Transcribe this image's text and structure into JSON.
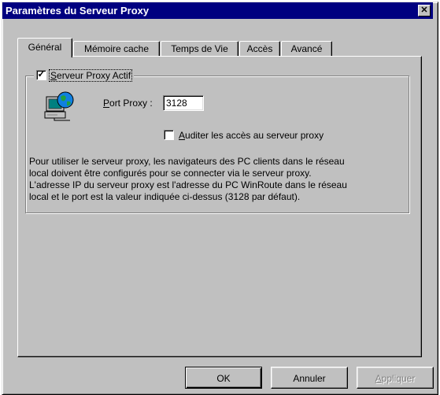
{
  "window": {
    "title": "Paramètres du Serveur Proxy",
    "close_glyph": "✕"
  },
  "tabs": [
    {
      "label": "Général",
      "active": true
    },
    {
      "label": "Mémoire cache",
      "active": false
    },
    {
      "label": "Temps de Vie",
      "active": false
    },
    {
      "label": "Accès",
      "active": false
    },
    {
      "label": "Avancé",
      "active": false
    }
  ],
  "proxy_group": {
    "enable_label_underlined": "S",
    "enable_label_rest": "erveur Proxy Actif",
    "enabled": true,
    "icon": "network-computer-icon"
  },
  "port": {
    "label_underlined": "P",
    "label_rest": "ort Proxy :",
    "value": "3128"
  },
  "audit": {
    "label_underlined": "A",
    "label_rest": "uditer les accès au serveur proxy",
    "checked": false
  },
  "info_lines": [
    "Pour utiliser le serveur proxy, les navigateurs des PC clients dans le réseau",
    "local doivent être configurés pour se connecter via le serveur proxy.",
    "L'adresse IP du serveur proxy est l'adresse du PC WinRoute dans le réseau",
    "local et le port est la valeur indiquée ci-dessus (3128 par défaut)."
  ],
  "buttons": {
    "ok": "OK",
    "cancel": "Annuler",
    "apply_underlined": "A",
    "apply_rest": "ppliquer",
    "apply_disabled": true
  },
  "colors": {
    "titlebar": "#000080",
    "face": "#c0c0c0"
  }
}
